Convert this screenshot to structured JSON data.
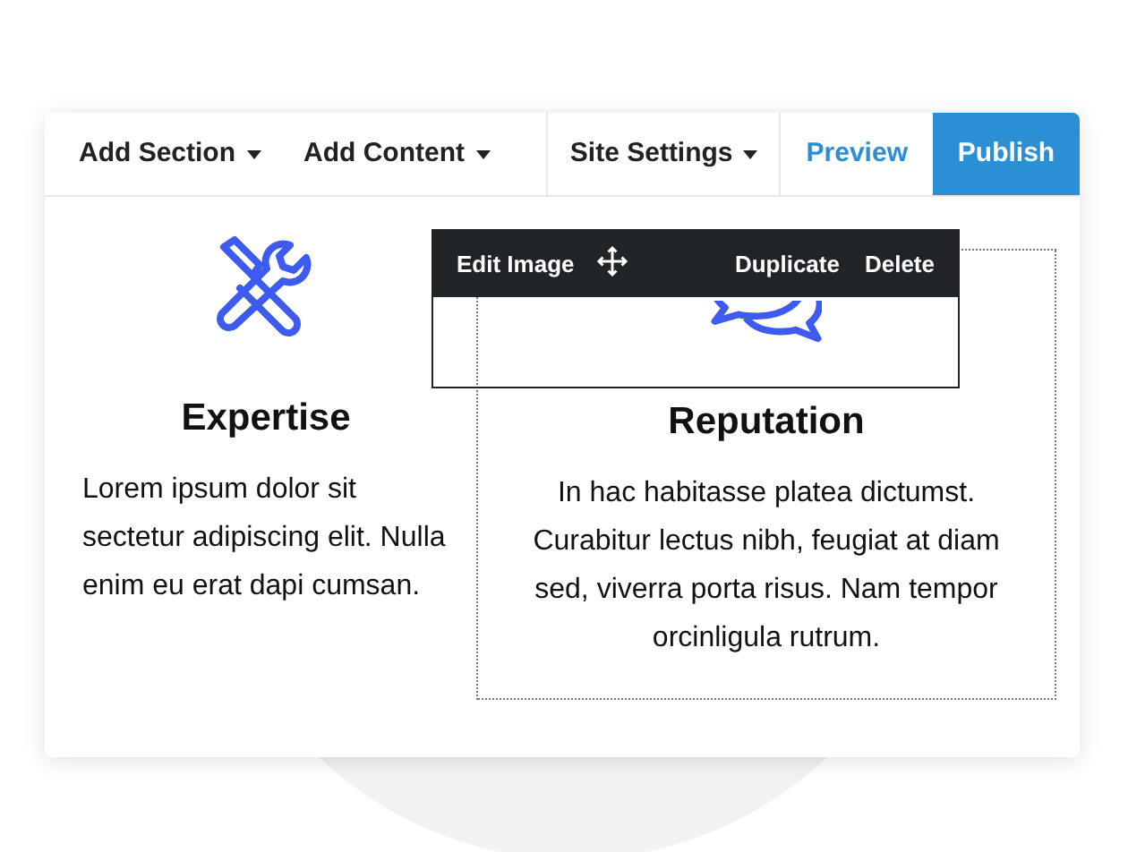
{
  "toolbar": {
    "menus": [
      {
        "label": "Add Section"
      },
      {
        "label": "Add Content"
      }
    ],
    "settings": {
      "label": "Site Settings"
    },
    "preview": {
      "label": "Preview"
    },
    "publish": {
      "label": "Publish"
    }
  },
  "features": [
    {
      "kind": "tools",
      "title": "Expertise",
      "text": "Lorem ipsum dolor sit sectetur adipiscing elit. Nulla enim eu erat dapi cumsan.",
      "selected": false
    },
    {
      "kind": "chat",
      "title": "Reputation",
      "text": "In hac habitasse platea dictumst. Curabitur lectus nibh, feugiat at diam sed, viverra porta risus. Nam tempor orcinligula rutrum.",
      "selected": true
    }
  ],
  "image_toolbar": {
    "edit": "Edit Image",
    "duplicate": "Duplicate",
    "delete": "Delete"
  }
}
